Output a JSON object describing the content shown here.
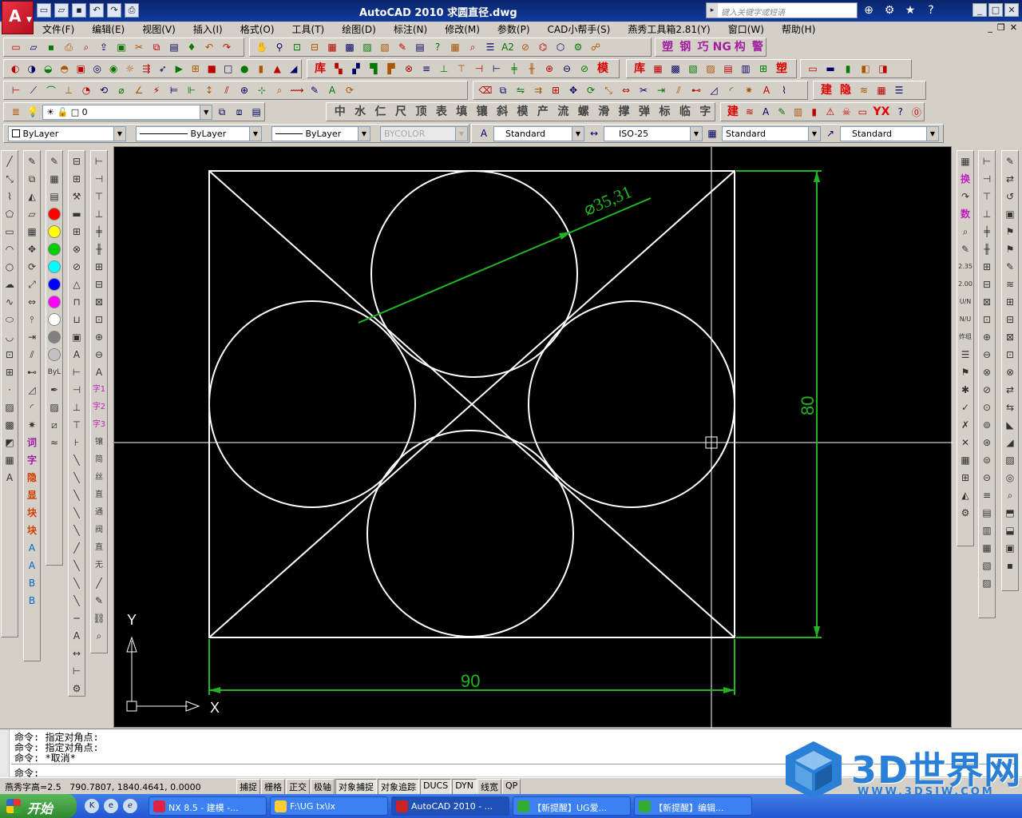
{
  "title": {
    "text": "AutoCAD 2010  求圆直径.dwg",
    "search_placeholder": "键入关键字或短语"
  },
  "menu": [
    "文件(F)",
    "编辑(E)",
    "视图(V)",
    "插入(I)",
    "格式(O)",
    "工具(T)",
    "绘图(D)",
    "标注(N)",
    "修改(M)",
    "参数(P)",
    "CAD小帮手(S)",
    "燕秀工具箱2.81(Y)",
    "窗口(W)",
    "帮助(H)"
  ],
  "toolbar": {
    "cjk_row2": [
      "塑",
      "钢",
      "巧",
      "NG",
      "构",
      "警"
    ],
    "cjk_row3a": [
      "库",
      "模"
    ],
    "cjk_row3b": [
      "库",
      "塑"
    ],
    "cjk_row4a": [
      "建",
      "隐"
    ],
    "cjk_row5": [
      "中",
      "水",
      "仁",
      "尺",
      "顶",
      "表",
      "填",
      "镶",
      "斜",
      "模",
      "产",
      "流",
      "螺",
      "滑",
      "撑",
      "弹",
      "标",
      "临",
      "字"
    ],
    "cjk_row5b": [
      "建",
      "YX"
    ],
    "layer_value": "0"
  },
  "properties": {
    "color": "ByLayer",
    "linetype": "ByLayer",
    "lineweight": "ByLayer",
    "plotstyle": "BYCOLOR",
    "text_style": "Standard",
    "dim_style": "ISO-25",
    "table_style": "Standard",
    "mleader_style": "Standard"
  },
  "left_panel": {
    "bylayer_label": "ByL",
    "cjk_items": [
      "词",
      "字",
      "隐",
      "显",
      "块",
      "块"
    ],
    "text_items": [
      "字1",
      "字2",
      "字3",
      "镶",
      "简",
      "丝",
      "直",
      "通",
      "阀",
      "直",
      "无"
    ]
  },
  "right_panel": {
    "cjk_items": [
      "换",
      "数"
    ],
    "small_labels": [
      "2.35",
      "2.00",
      "U/N",
      "N/U",
      "炸组"
    ]
  },
  "drawing": {
    "diameter_label": "⌀35,31",
    "width_label": "90",
    "height_label": "80",
    "ucs_x": "X",
    "ucs_y": "Y"
  },
  "command": {
    "lines": [
      "命令: 指定对角点:",
      "命令: 指定对角点:",
      "命令: *取消*"
    ],
    "prompt": "命令:"
  },
  "status": {
    "text_height": "燕秀字高=2.5",
    "coords": "790.7807, 1840.4641, 0.0000",
    "toggles": [
      "捕捉",
      "栅格",
      "正交",
      "极轴",
      "对象捕捉",
      "对象追踪",
      "DUCS",
      "DYN",
      "线宽",
      "QP"
    ]
  },
  "taskbar": {
    "start": "开始",
    "tasks": [
      "NX 8.5 - 建模 -...",
      "F:\\UG tx\\lx",
      "AutoCAD 2010 - ...",
      "【新提醒】UG爱...",
      "【新提醒】编辑..."
    ]
  },
  "watermark": {
    "brand": "3D世界网",
    "url": "WWW.3DSJW.COM"
  },
  "colors": {
    "dimension_green": "#22b522",
    "geometry_white": "#ffffff",
    "canvas_bg": "#000000"
  }
}
